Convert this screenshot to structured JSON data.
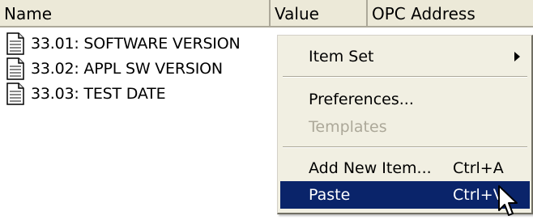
{
  "list": {
    "columns": [
      "Name",
      "Value",
      "OPC Address"
    ],
    "items": [
      {
        "label": "33.01: SOFTWARE VERSION",
        "icon": "document-icon"
      },
      {
        "label": "33.02: APPL SW VERSION",
        "icon": "document-icon"
      },
      {
        "label": "33.03: TEST DATE",
        "icon": "document-icon"
      }
    ]
  },
  "context_menu": {
    "items": [
      {
        "label": "Item Set",
        "shortcut": "",
        "submenu": true,
        "enabled": true
      },
      {
        "label": "Preferences...",
        "shortcut": "",
        "enabled": true
      },
      {
        "label": "Templates",
        "shortcut": "",
        "enabled": false
      },
      {
        "label": "Add New Item...",
        "shortcut": "Ctrl+A",
        "enabled": true
      },
      {
        "label": "Paste",
        "shortcut": "Ctrl+V",
        "enabled": true,
        "highlighted": true
      }
    ]
  },
  "colors": {
    "header_bg": "#ece9d8",
    "menu_bg": "#f1efe2",
    "highlight_bg": "#0a246a",
    "disabled_text": "#aca899"
  }
}
